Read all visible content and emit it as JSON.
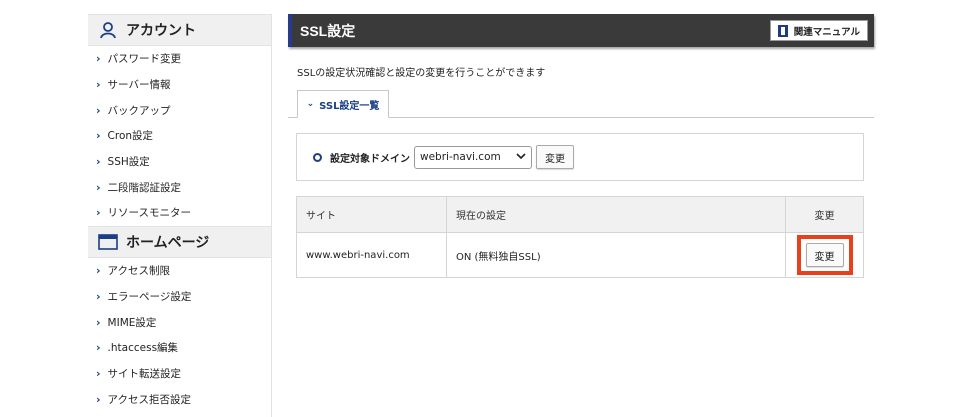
{
  "sidebar": {
    "account": {
      "title": "アカウント",
      "items": [
        "パスワード変更",
        "サーバー情報",
        "バックアップ",
        "Cron設定",
        "SSH設定",
        "二段階認証設定",
        "リソースモニター"
      ]
    },
    "homepage": {
      "title": "ホームページ",
      "items": [
        "アクセス制限",
        "エラーページ設定",
        "MIME設定",
        ".htaccess編集",
        "サイト転送設定",
        "アクセス拒否設定"
      ]
    }
  },
  "header": {
    "title": "SSL設定",
    "manual_label": "関連マニュアル"
  },
  "description": "SSLの設定状況確認と設定の変更を行うことができます",
  "tab_label": "SSL設定一覧",
  "domain_select": {
    "label": "設定対象ドメイン",
    "value": "webri-navi.com",
    "button_label": "変更"
  },
  "table": {
    "headers": [
      "サイト",
      "現在の設定",
      "変更"
    ],
    "rows": [
      {
        "site": "www.webri-navi.com",
        "setting": "ON (無料独自SSL)",
        "action": "変更"
      }
    ]
  },
  "colors": {
    "accent": "#1a3f86",
    "highlight": "#e8401c",
    "titlebar": "#3a3a3a"
  }
}
